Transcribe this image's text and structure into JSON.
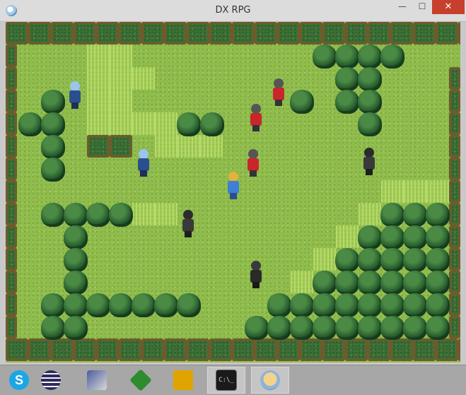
{
  "window": {
    "title": "DX RPG"
  },
  "controls": {
    "minimize": "—",
    "maximize": "☐",
    "close": "✕"
  },
  "taskbar": {
    "items": [
      {
        "name": "skype-icon",
        "color": "#1aa7e6"
      },
      {
        "name": "eclipse-icon",
        "color": "#2c2a5e"
      },
      {
        "name": "movie-maker-icon",
        "color": "#4a5c9e"
      },
      {
        "name": "vim-icon",
        "color": "#2e8b2e"
      },
      {
        "name": "folder-tool-icon",
        "color": "#e0a400"
      },
      {
        "name": "terminal-icon",
        "color": "#1a1a1a",
        "label": "C:\\_"
      },
      {
        "name": "dx-rpg-app-icon",
        "color": "#f0c070"
      }
    ]
  },
  "colors": {
    "grass": "#8fbc4c",
    "hedge": "#3b6e35",
    "tree": "#245a2c",
    "close_button": "#c7402d"
  }
}
